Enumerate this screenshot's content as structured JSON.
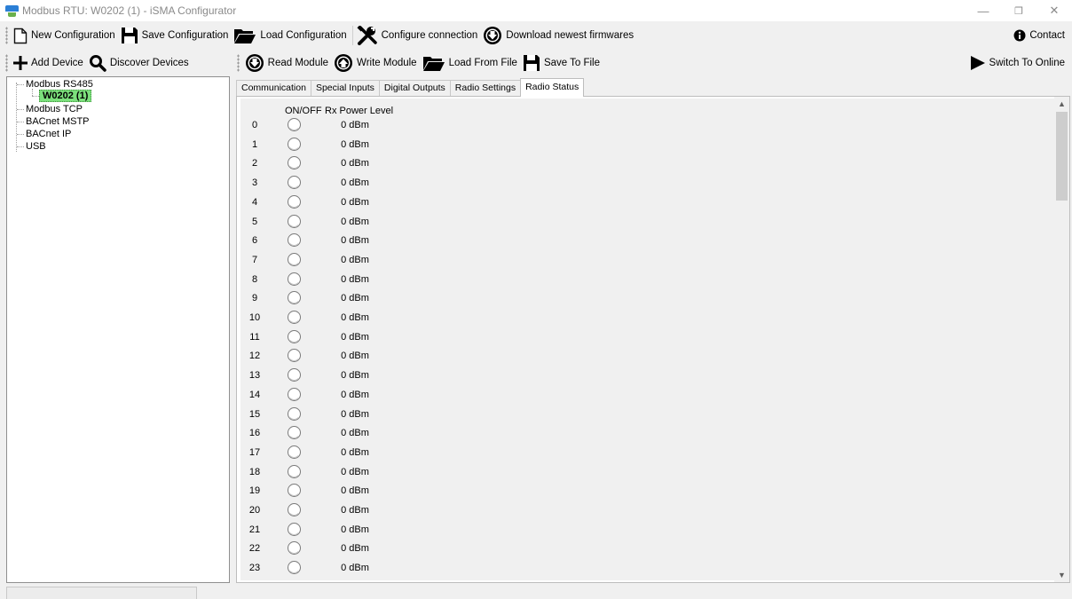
{
  "window": {
    "title": "Modbus RTU: W0202 (1) - iSMA Configurator",
    "minimize_glyph": "—",
    "restore_glyph": "❐",
    "close_glyph": "✕"
  },
  "toolbar_main": {
    "new_config": "New Configuration",
    "save_config": "Save Configuration",
    "load_config": "Load Configuration",
    "configure_connection": "Configure connection",
    "download_firmware": "Download newest firmwares",
    "contact": "Contact"
  },
  "toolbar_device": {
    "add_device": "Add Device",
    "discover_devices": "Discover Devices"
  },
  "toolbar_module": {
    "read_module": "Read Module",
    "write_module": "Write Module",
    "load_from_file": "Load From File",
    "save_to_file": "Save To File",
    "switch_to_online": "Switch To Online"
  },
  "tree": {
    "items": [
      "Modbus RS485",
      "W0202 (1)",
      "Modbus TCP",
      "BACnet MSTP",
      "BACnet IP",
      "USB"
    ]
  },
  "tabs": [
    {
      "label": "Communication",
      "active": false
    },
    {
      "label": "Special Inputs",
      "active": false
    },
    {
      "label": "Digital Outputs",
      "active": false
    },
    {
      "label": "Radio Settings",
      "active": false
    },
    {
      "label": "Radio Status",
      "active": true
    }
  ],
  "radio_status": {
    "col_onoff": "ON/OFF",
    "col_power": "Rx Power Level",
    "rows": [
      {
        "channel": "0",
        "power": "0 dBm"
      },
      {
        "channel": "1",
        "power": "0 dBm"
      },
      {
        "channel": "2",
        "power": "0 dBm"
      },
      {
        "channel": "3",
        "power": "0 dBm"
      },
      {
        "channel": "4",
        "power": "0 dBm"
      },
      {
        "channel": "5",
        "power": "0 dBm"
      },
      {
        "channel": "6",
        "power": "0 dBm"
      },
      {
        "channel": "7",
        "power": "0 dBm"
      },
      {
        "channel": "8",
        "power": "0 dBm"
      },
      {
        "channel": "9",
        "power": "0 dBm"
      },
      {
        "channel": "10",
        "power": "0 dBm"
      },
      {
        "channel": "11",
        "power": "0 dBm"
      },
      {
        "channel": "12",
        "power": "0 dBm"
      },
      {
        "channel": "13",
        "power": "0 dBm"
      },
      {
        "channel": "14",
        "power": "0 dBm"
      },
      {
        "channel": "15",
        "power": "0 dBm"
      },
      {
        "channel": "16",
        "power": "0 dBm"
      },
      {
        "channel": "17",
        "power": "0 dBm"
      },
      {
        "channel": "18",
        "power": "0 dBm"
      },
      {
        "channel": "19",
        "power": "0 dBm"
      },
      {
        "channel": "20",
        "power": "0 dBm"
      },
      {
        "channel": "21",
        "power": "0 dBm"
      },
      {
        "channel": "22",
        "power": "0 dBm"
      },
      {
        "channel": "23",
        "power": "0 dBm"
      }
    ]
  },
  "colors": {
    "selected_node": "#7ce07c",
    "led_off": "#ffffff"
  }
}
